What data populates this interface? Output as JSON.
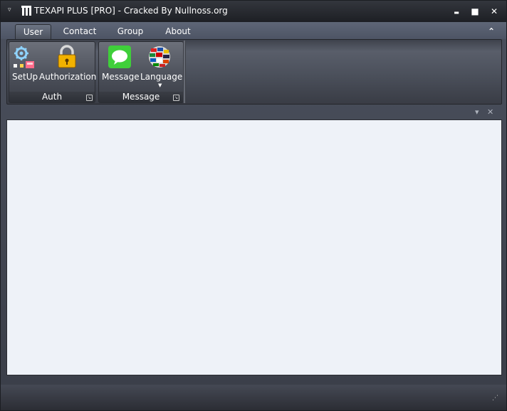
{
  "window": {
    "title": "TEXAPI PLUS [PRO] - Cracked By Nullnoss.org",
    "controls": {
      "menu_glyph": "▿",
      "minimize_glyph": "▬",
      "maximize_glyph": "■",
      "close_glyph": "✕"
    }
  },
  "tabs": [
    {
      "label": "User",
      "active": true
    },
    {
      "label": "Contact",
      "active": false
    },
    {
      "label": "Group",
      "active": false
    },
    {
      "label": "About",
      "active": false
    }
  ],
  "ribbon": {
    "collapse_glyph": "⌃",
    "groups": [
      {
        "label": "Auth",
        "buttons": [
          {
            "label": "SetUp",
            "icon": "setup-gear-icon"
          },
          {
            "label": "Authorization",
            "icon": "padlock-icon"
          }
        ]
      },
      {
        "label": "Message",
        "buttons": [
          {
            "label": "Message",
            "icon": "chat-bubble-icon"
          },
          {
            "label": "Language",
            "icon": "flags-globe-icon",
            "has_dropdown": true
          }
        ]
      }
    ],
    "launcher_glyph": "↘",
    "dropdown_glyph": "▼"
  },
  "panel": {
    "pin_glyph": "▾",
    "close_glyph": "✕"
  },
  "status": {
    "grip_glyph": "⋰"
  },
  "colors": {
    "titlebar": "#1d1f24",
    "ribbon": "#4b505b",
    "content": "#eef2f8",
    "message_icon": "#3fcf3a",
    "lock_icon": "#f2b200"
  }
}
